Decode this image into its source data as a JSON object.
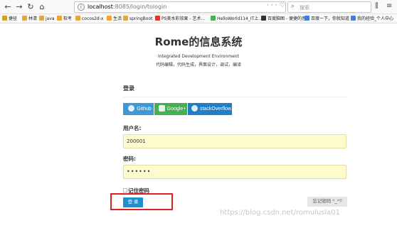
{
  "browser": {
    "url_host": "localhost",
    "url_path": ":8085/login/tologin",
    "search_placeholder": "搜索"
  },
  "bookmarks": [
    {
      "label": "捷径",
      "color": "#d4a017"
    },
    {
      "label": "林清",
      "color": "#e9a53d"
    },
    {
      "label": "java",
      "color": "#e9a53d"
    },
    {
      "label": "软考",
      "color": "#e9a53d"
    },
    {
      "label": "cocos2d-x",
      "color": "#e9a53d"
    },
    {
      "label": "生活",
      "color": "#e9a53d"
    },
    {
      "label": "springBoot",
      "color": "#e9a53d"
    },
    {
      "label": "PS美水彩效果 - 艺术...",
      "color": "#d83a2b"
    },
    {
      "label": "HelloWorld114_IT上...",
      "color": "#4caf50"
    },
    {
      "label": "百度脑图 - 便捷的思...",
      "color": "#333333"
    },
    {
      "label": "百度一下，你就知道",
      "color": "#3d7ee0"
    },
    {
      "label": "我的经验_个人中心",
      "color": "#3d7ee0"
    }
  ],
  "page": {
    "title": "Rome的信息系统",
    "subtitle_en": "Integrated Development Environment",
    "subtitle_cn": "代码编辑，代码生成，界面设计，调试，编译"
  },
  "login": {
    "section_title": "登录",
    "social": {
      "github": "Github",
      "google": "Google+",
      "stackoverflow": "stackOverflow"
    },
    "username_label": "用户名:",
    "username_value": "200001",
    "password_label": "密码:",
    "password_value": "••••••",
    "remember_label": "记住密码",
    "submit_label": "登 录",
    "forgot_label": "忘记密码 ^_^?"
  },
  "watermark": "https://blog.csdn.net/romulusla01"
}
